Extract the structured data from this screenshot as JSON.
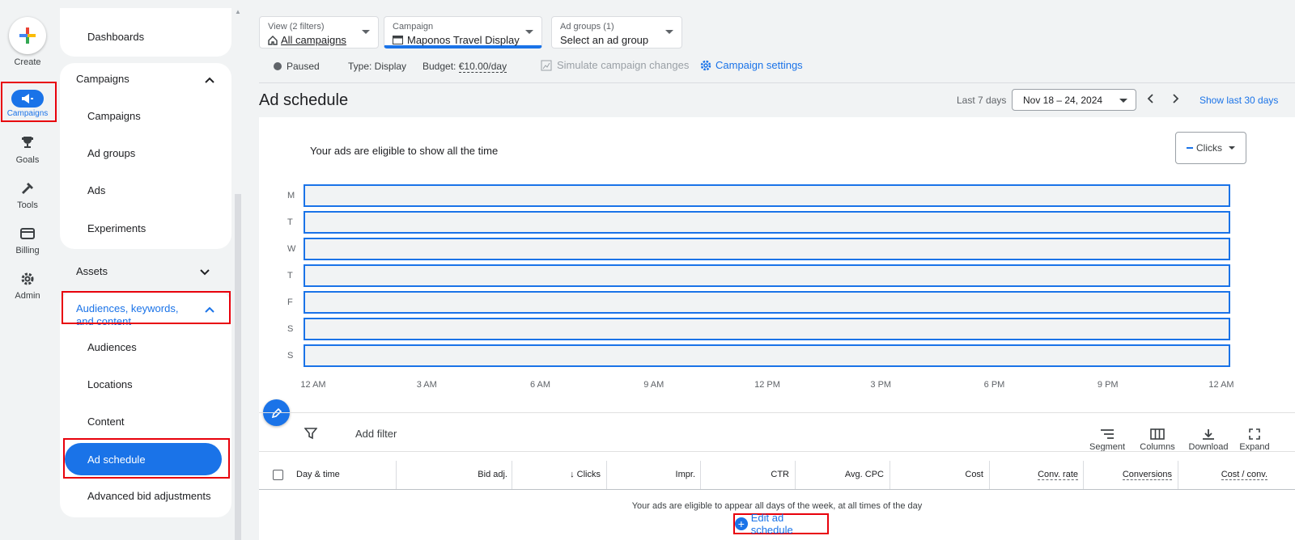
{
  "rail": {
    "create": "Create",
    "campaigns": "Campaigns",
    "goals": "Goals",
    "tools": "Tools",
    "billing": "Billing",
    "admin": "Admin"
  },
  "nav": {
    "dashboards": "Dashboards",
    "campaigns_head": "Campaigns",
    "campaigns": "Campaigns",
    "ad_groups": "Ad groups",
    "ads": "Ads",
    "experiments": "Experiments",
    "assets": "Assets",
    "audiences_head": "Audiences, keywords, and content",
    "audiences": "Audiences",
    "locations": "Locations",
    "content": "Content",
    "ad_schedule": "Ad schedule",
    "advanced_bid": "Advanced bid adjustments"
  },
  "filters": {
    "view_label": "View (2 filters)",
    "view_value": "All campaigns",
    "campaign_label": "Campaign",
    "campaign_value": "Maponos Travel Display",
    "adgroups_label": "Ad groups (1)",
    "adgroups_value": "Select an ad group"
  },
  "status": {
    "paused": "Paused",
    "type": "Type: Display",
    "budget_label": "Budget:",
    "budget_value": "€10.00/day",
    "simulate": "Simulate campaign changes",
    "settings": "Campaign settings"
  },
  "page": {
    "title": "Ad schedule",
    "range_label": "Last 7 days",
    "range_value": "Nov 18 – 24, 2024",
    "show_last": "Show last 30 days"
  },
  "chart": {
    "heading": "Your ads are eligible to show all the time",
    "metric": "Clicks",
    "days": [
      "M",
      "T",
      "W",
      "T",
      "F",
      "S",
      "S"
    ],
    "hours": [
      "12 AM",
      "3 AM",
      "6 AM",
      "9 AM",
      "12 PM",
      "3 PM",
      "6 PM",
      "9 PM",
      "12 AM"
    ]
  },
  "table": {
    "add_filter": "Add filter",
    "segment": "Segment",
    "columns": "Columns",
    "download": "Download",
    "expand": "Expand",
    "headers": [
      "Day & time",
      "Bid adj.",
      "Clicks",
      "Impr.",
      "CTR",
      "Avg. CPC",
      "Cost",
      "Conv. rate",
      "Conversions",
      "Cost / conv."
    ],
    "empty": "Your ads are eligible to appear all days of the week, at all times of the day",
    "edit": "Edit ad schedule"
  },
  "colors": {
    "accent": "#1a73e8",
    "highlight": "#e8000b"
  }
}
